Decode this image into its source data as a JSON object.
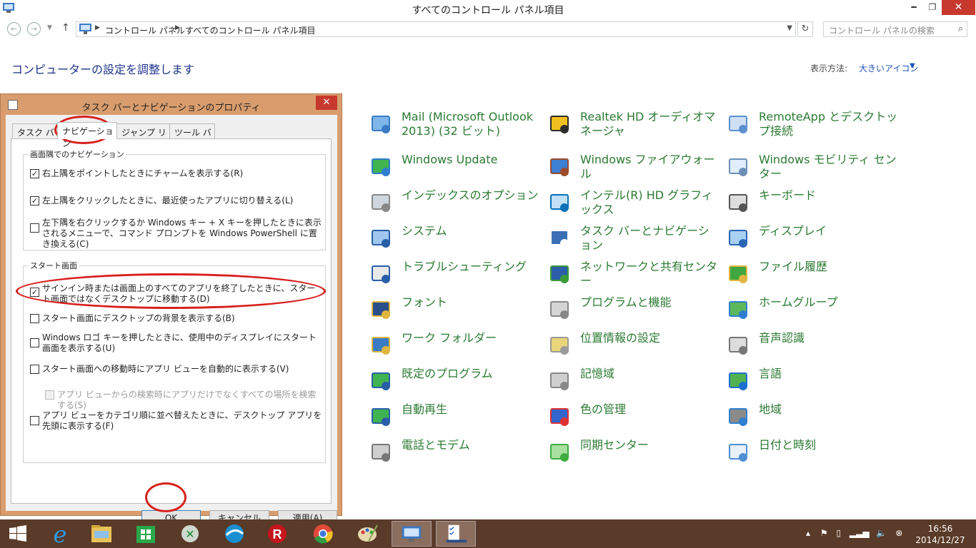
{
  "window": {
    "title": "すべてのコントロール パネル項目"
  },
  "address": {
    "crumbs": [
      "コントロール パネル",
      "すべてのコントロール パネル項目"
    ],
    "search_placeholder": "コントロール パネルの検索"
  },
  "content": {
    "heading": "コンピューターの設定を調整します",
    "view_label": "表示方法:",
    "view_value": "大きいアイコン"
  },
  "items": [
    {
      "label": "Mail (Microsoft Outlook 2013) (32 ビット)",
      "icon": "mail-icon"
    },
    {
      "label": "Realtek HD オーディオマネージャ",
      "icon": "audio-manager-icon"
    },
    {
      "label": "RemoteApp とデスクトップ接続",
      "icon": "remoteapp-icon"
    },
    {
      "label": "Windows Update",
      "icon": "windows-update-icon"
    },
    {
      "label": "Windows ファイアウォール",
      "icon": "firewall-icon"
    },
    {
      "label": "Windows モビリティ センター",
      "icon": "mobility-center-icon"
    },
    {
      "label": "インデックスのオプション",
      "icon": "indexing-icon"
    },
    {
      "label": "インテル(R) HD グラフィックス",
      "icon": "intel-graphics-icon"
    },
    {
      "label": "キーボード",
      "icon": "keyboard-icon"
    },
    {
      "label": "システム",
      "icon": "system-icon"
    },
    {
      "label": "タスク バーとナビゲーション",
      "icon": "taskbar-icon"
    },
    {
      "label": "ディスプレイ",
      "icon": "display-icon"
    },
    {
      "label": "トラブルシューティング",
      "icon": "troubleshooting-icon"
    },
    {
      "label": "ネットワークと共有センター",
      "icon": "network-icon"
    },
    {
      "label": "ファイル履歴",
      "icon": "file-history-icon"
    },
    {
      "label": "フォント",
      "icon": "fonts-icon"
    },
    {
      "label": "プログラムと機能",
      "icon": "programs-icon"
    },
    {
      "label": "ホームグループ",
      "icon": "homegroup-icon"
    },
    {
      "label": "ワーク フォルダー",
      "icon": "work-folders-icon"
    },
    {
      "label": "位置情報の設定",
      "icon": "location-icon"
    },
    {
      "label": "音声認識",
      "icon": "microphone-icon"
    },
    {
      "label": "既定のプログラム",
      "icon": "default-programs-icon"
    },
    {
      "label": "記憶域",
      "icon": "storage-icon"
    },
    {
      "label": "言語",
      "icon": "language-icon"
    },
    {
      "label": "自動再生",
      "icon": "autoplay-icon"
    },
    {
      "label": "色の管理",
      "icon": "color-management-icon"
    },
    {
      "label": "地域",
      "icon": "region-icon"
    },
    {
      "label": "電話とモデム",
      "icon": "phone-modem-icon"
    },
    {
      "label": "同期センター",
      "icon": "sync-center-icon"
    },
    {
      "label": "日付と時刻",
      "icon": "date-time-icon"
    }
  ],
  "dialog": {
    "title": "タスク バーとナビゲーションのプロパティ",
    "tabs": [
      "タスク バー",
      "ナビゲーション",
      "ジャンプ リスト",
      "ツール バー"
    ],
    "group1": {
      "title": "画面隅でのナビゲーション",
      "options": [
        {
          "label": "右上隅をポイントしたときにチャームを表示する(R)",
          "checked": true
        },
        {
          "label": "左上隅をクリックしたときに、最近使ったアプリに切り替える(L)",
          "checked": true
        },
        {
          "label": "左下隅を右クリックするか Windows キー + X キーを押したときに表示されるメニューで、コマンド プロンプトを Windows PowerShell に置き換える(C)",
          "checked": false
        }
      ]
    },
    "group2": {
      "title": "スタート画面",
      "options": [
        {
          "label": "サインイン時または画面上のすべてのアプリを終了したときに、スタート画面ではなくデスクトップに移動する(D)",
          "checked": true
        },
        {
          "label": "スタート画面にデスクトップの背景を表示する(B)",
          "checked": false
        },
        {
          "label": "Windows ロゴ キーを押したときに、使用中のディスプレイにスタート画面を表示する(U)",
          "checked": false
        },
        {
          "label": "スタート画面への移動時にアプリ ビューを自動的に表示する(V)",
          "checked": false
        },
        {
          "label": "アプリ ビューからの検索時にアプリだけでなくすべての場所を検索する(S)",
          "checked": false,
          "disabled": true
        },
        {
          "label": "アプリ ビューをカテゴリ順に並べ替えたときに、デスクトップ アプリを先頭に表示する(F)",
          "checked": false
        }
      ]
    },
    "buttons": {
      "ok": "OK",
      "cancel": "キャンセル",
      "apply": "適用(A)"
    }
  },
  "taskbar": {
    "time": "16:56",
    "date": "2014/12/27"
  }
}
